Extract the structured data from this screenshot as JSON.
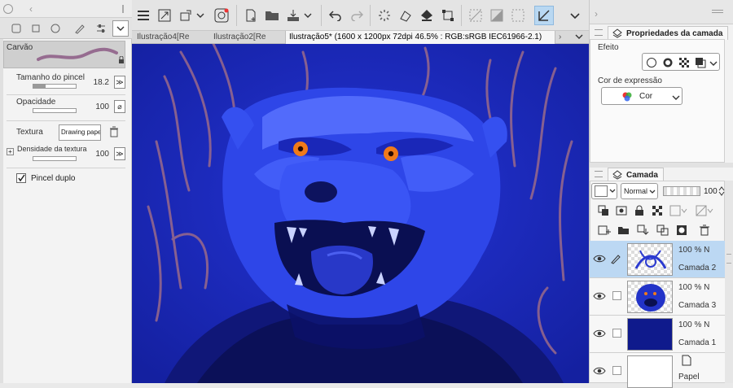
{
  "left_panel": {
    "brush_name": "Carvão",
    "properties": [
      {
        "label": "Tamanho do pincel",
        "value": "18.2"
      },
      {
        "label": "Opacidade",
        "value": "100"
      },
      {
        "label": "Textura",
        "value": "Drawing paper"
      },
      {
        "label": "Densidade da textura",
        "value": "100"
      }
    ],
    "dual_brush_label": "Pincel duplo"
  },
  "document_tabs": [
    {
      "label": "Ilustração4[Re"
    },
    {
      "label": "Ilustração2[Re"
    },
    {
      "label": "Ilustração5* (1600 x 1200px 72dpi 46.5% : RGB:sRGB IEC61966-2.1)"
    }
  ],
  "right_panel": {
    "layer_props_title": "Propriedades da camada",
    "effect_label": "Efeito",
    "expression_color_label": "Cor de expressão",
    "expression_color_value": "Cor",
    "layers_title": "Camada",
    "blend_mode": "Normal",
    "layer_opacity": "100",
    "layers": [
      {
        "opacity": "100 % N",
        "name": "Camada 2",
        "selected": true
      },
      {
        "opacity": "100 % N",
        "name": "Camada 3",
        "selected": false
      },
      {
        "opacity": "100 % N",
        "name": "Camada 1",
        "selected": false
      },
      {
        "opacity": "",
        "name": "Papel",
        "selected": false
      }
    ]
  },
  "colors": {
    "canvas_bg": "#1d2bb5",
    "selection_blue": "#bcd8f3",
    "stroke_mauve": "#9a6a8a",
    "eye_orange": "#f07a1a"
  }
}
